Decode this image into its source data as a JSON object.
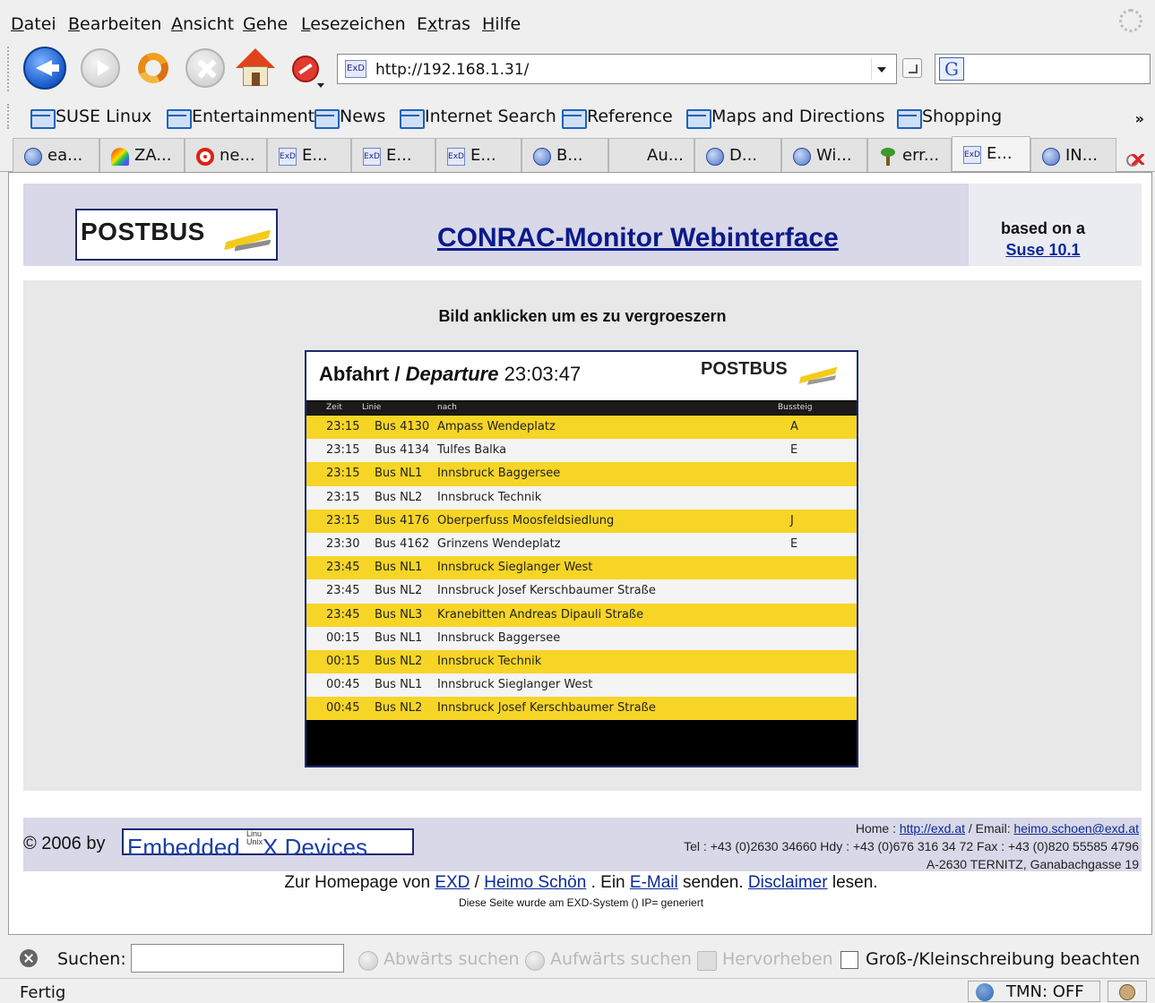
{
  "menu": [
    {
      "accel": "D",
      "rest": "atei"
    },
    {
      "accel": "B",
      "rest": "earbeiten"
    },
    {
      "accel": "A",
      "rest": "nsicht"
    },
    {
      "accel": "G",
      "rest": "ehe"
    },
    {
      "accel": "L",
      "rest": "esezeichen"
    },
    {
      "pre": "E",
      "accel": "x",
      "rest": "tras"
    },
    {
      "accel": "H",
      "rest": "ilfe"
    }
  ],
  "nav": {
    "url": "http://192.168.1.31/",
    "site_icon": "ExD",
    "search_engine_icon": "G",
    "search_value": ""
  },
  "bookmarks": [
    "SUSE Linux",
    "Entertainment",
    "News",
    "Internet Search",
    "Reference",
    "Maps and Directions",
    "Shopping"
  ],
  "bookmarks_more": "»",
  "tabs": [
    {
      "label": "ea...",
      "icon": "globe-icon"
    },
    {
      "label": "ZA...",
      "icon": "rainbow-icon"
    },
    {
      "label": "ne...",
      "icon": "target-icon"
    },
    {
      "label": "E...",
      "icon": "exd-icon"
    },
    {
      "label": "E...",
      "icon": "exd-icon"
    },
    {
      "label": "E...",
      "icon": "exd-icon"
    },
    {
      "label": "B...",
      "icon": "globe-icon"
    },
    {
      "label": "Au...",
      "icon": "none"
    },
    {
      "label": "D...",
      "icon": "globe-icon"
    },
    {
      "label": "Wi...",
      "icon": "globe-icon"
    },
    {
      "label": "err...",
      "icon": "plant-icon"
    },
    {
      "label": "E...",
      "icon": "exd-icon"
    },
    {
      "label": "IN...",
      "icon": "globe-icon"
    }
  ],
  "page": {
    "logo_text": "POSTBUS",
    "title": "CONRAC-Monitor Webinterface",
    "based_on": "based on a",
    "suse_link": "Suse 10.1",
    "instruction": "Bild anklicken um es zu vergroeszern"
  },
  "board": {
    "title_bold": "Abfahrt",
    "title_sep": " / ",
    "title_italic": "Departure",
    "time": "23:03:47",
    "logo": "POSTBUS",
    "col_zeit": "Zeit",
    "col_linie": "Linie",
    "col_nach": "nach",
    "col_bussteig": "Bussteig",
    "rows": [
      {
        "time": "23:15",
        "line": "Bus 4130",
        "dest": "Ampass Wendeplatz",
        "stop": "A"
      },
      {
        "time": "23:15",
        "line": "Bus 4134",
        "dest": "Tulfes Balka",
        "stop": "E"
      },
      {
        "time": "23:15",
        "line": "Bus NL1",
        "dest": "Innsbruck Baggersee",
        "stop": ""
      },
      {
        "time": "23:15",
        "line": "Bus NL2",
        "dest": "Innsbruck Technik",
        "stop": ""
      },
      {
        "time": "23:15",
        "line": "Bus 4176",
        "dest": "Oberperfuss Moosfeldsiedlung",
        "stop": "J"
      },
      {
        "time": "23:30",
        "line": "Bus 4162",
        "dest": "Grinzens Wendeplatz",
        "stop": "E"
      },
      {
        "time": "23:45",
        "line": "Bus NL1",
        "dest": "Innsbruck Sieglanger West",
        "stop": ""
      },
      {
        "time": "23:45",
        "line": "Bus NL2",
        "dest": "Innsbruck Josef Kerschbaumer Straße",
        "stop": ""
      },
      {
        "time": "23:45",
        "line": "Bus NL3",
        "dest": "Kranebitten Andreas Dipauli Straße",
        "stop": ""
      },
      {
        "time": "00:15",
        "line": "Bus NL1",
        "dest": "Innsbruck Baggersee",
        "stop": ""
      },
      {
        "time": "00:15",
        "line": "Bus NL2",
        "dest": "Innsbruck Technik",
        "stop": ""
      },
      {
        "time": "00:45",
        "line": "Bus NL1",
        "dest": "Innsbruck Sieglanger West",
        "stop": ""
      },
      {
        "time": "00:45",
        "line": "Bus NL2",
        "dest": "Innsbruck Josef Kerschbaumer Straße",
        "stop": ""
      }
    ]
  },
  "footer": {
    "copyright": "© 2006 by",
    "exd_pre": "Embedded ",
    "exd_small1": "Linu",
    "exd_small2": "Unix",
    "exd_post": "X Devices",
    "home_label": "Home : ",
    "home_url": "http://exd.at",
    "email_label": " / Email: ",
    "email": "heimo.schoen@exd.at",
    "phone": "Tel : +43 (0)2630 34660 Hdy : +43 (0)676 316 34 72 Fax : +43 (0)820 55585 4796",
    "address": "A-2630 TERNITZ, Ganabachgasse 19",
    "links_pre": "Zur Homepage von ",
    "link_exd": "EXD",
    "links_sep1": " / ",
    "link_heimo": "Heimo Schön",
    "links_sep2": " . Ein ",
    "link_email": "E-Mail",
    "links_sep3": " senden. ",
    "link_disclaimer": "Disclaimer",
    "links_post": " lesen.",
    "generated": "Diese Seite wurde am EXD-System () IP= generiert"
  },
  "findbar": {
    "label": "Suchen:",
    "value": "",
    "next": "Abwärts suchen",
    "prev": "Aufwärts suchen",
    "highlight": "Hervorheben",
    "match_case": "Groß-/Kleinschreibung beachten"
  },
  "status": {
    "text": "Fertig",
    "tmn": "TMN: OFF"
  }
}
